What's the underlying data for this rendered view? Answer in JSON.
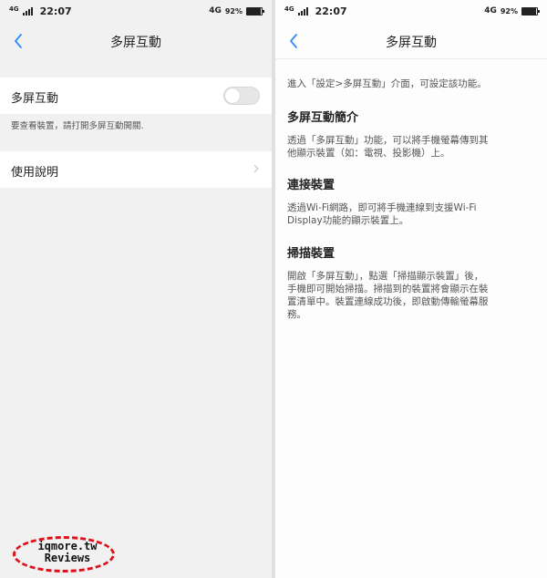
{
  "status_bar": {
    "network_type": "4G",
    "time": "22:07",
    "data_type": "4G",
    "battery_percent": "92%",
    "battery_level": 0.92
  },
  "left": {
    "title": "多屏互動",
    "toggle_label": "多屏互動",
    "toggle_on": false,
    "hint": "要查看裝置，請打開多屏互動開關.",
    "manual_label": "使用說明"
  },
  "right": {
    "title": "多屏互動",
    "intro": "進入「設定>多屏互動」介面，可設定該功能。",
    "sections": [
      {
        "heading": "多屏互動簡介",
        "lines": [
          "透過「多屏互動」功能，可以將手機螢幕傳到其",
          "他顯示裝置（如：電視、投影機）上。"
        ]
      },
      {
        "heading": "連接裝置",
        "lines": [
          "透過Wi-Fi網路，即可將手機連線到支援Wi-Fi",
          "Display功能的顯示裝置上。"
        ]
      },
      {
        "heading": "掃描裝置",
        "lines": [
          "開啟「多屏互動」，點選「掃描顯示裝置」後，",
          "手機即可開始掃描。掃描到的裝置將會顯示在裝",
          "置清單中。裝置連線成功後，即啟動傳輸螢幕服",
          "務。"
        ]
      }
    ]
  },
  "watermark": {
    "line1": "iqmore.tw",
    "line2": "Reviews",
    "color": "#e0101a"
  },
  "icons": [
    "chevron-left-icon",
    "chevron-right-icon",
    "signal-icon",
    "battery-icon"
  ]
}
